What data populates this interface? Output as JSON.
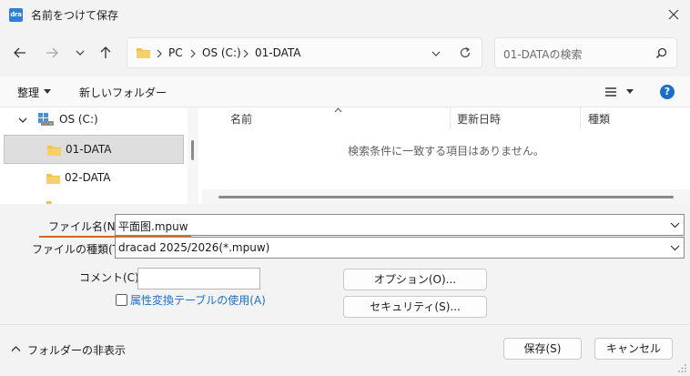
{
  "window": {
    "icon_text": "dra",
    "title": "名前をつけて保存"
  },
  "address": {
    "crumbs": [
      "PC",
      "OS (C:)",
      "01-DATA"
    ]
  },
  "search": {
    "placeholder": "01-DATAの検索"
  },
  "toolbar": {
    "organize_label": "整理",
    "new_folder_label": "新しいフォルダー",
    "help_label": "?"
  },
  "tree": [
    {
      "label": "OS (C:)",
      "icon": "drive-icon"
    },
    {
      "label": "01-DATA",
      "icon": "folder-icon",
      "selected": true
    },
    {
      "label": "02-DATA",
      "icon": "folder-icon"
    }
  ],
  "file_list": {
    "columns": [
      "名前",
      "更新日時",
      "種類"
    ],
    "empty_message": "検索条件に一致する項目はありません。"
  },
  "form": {
    "filename_label": "ファイル名(N):",
    "filename_value": "平面图.mpuw",
    "filetype_label": "ファイルの種類(T):",
    "filetype_value": "dracad 2025/2026(*.mpuw)",
    "comment_label": "コメント(C)：",
    "comment_value": "",
    "attribute_checkbox_label": "属性変換テーブルの使用(A)",
    "options_button": "オプション(O)...",
    "security_button": "セキュリティ(S)..."
  },
  "footer": {
    "hide_folders_label": "フォルダーの非表示",
    "save_button": "保存(S)",
    "cancel_button": "キャンセル"
  },
  "colors": {
    "accent": "#1a6fc9",
    "folder": "#f5c242",
    "underline": "#d9641c"
  }
}
